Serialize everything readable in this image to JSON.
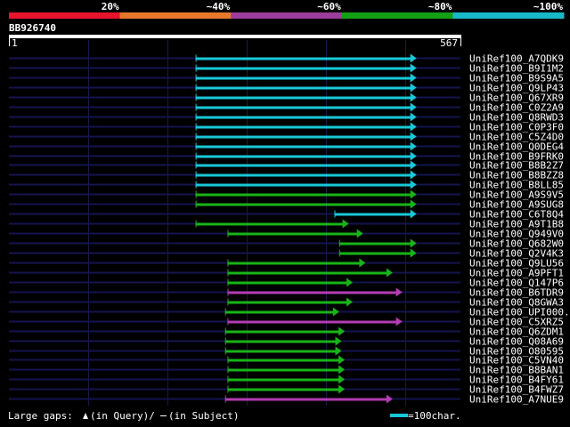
{
  "legend": {
    "colors": [
      "#e8142c",
      "#e8782c",
      "#9c3c9c",
      "#14a014",
      "#18b8c8"
    ],
    "labels": [
      "20%",
      "~40%",
      "~60%",
      "~80%",
      "~100%"
    ]
  },
  "query": {
    "name": "BB926740",
    "start": "1",
    "end": "567"
  },
  "hits": [
    {
      "name": "UniRef100_A7QDK9",
      "start": 235,
      "end": 512,
      "color": "cyan"
    },
    {
      "name": "UniRef100_B9I1M2",
      "start": 235,
      "end": 512,
      "color": "cyan"
    },
    {
      "name": "UniRef100_B9S9A5",
      "start": 235,
      "end": 512,
      "color": "cyan"
    },
    {
      "name": "UniRef100_Q9LP43",
      "start": 235,
      "end": 512,
      "color": "cyan"
    },
    {
      "name": "UniRef100_Q67XR9",
      "start": 235,
      "end": 512,
      "color": "cyan"
    },
    {
      "name": "UniRef100_C0Z2A9",
      "start": 235,
      "end": 512,
      "color": "cyan"
    },
    {
      "name": "UniRef100_Q8RWD3",
      "start": 235,
      "end": 512,
      "color": "cyan"
    },
    {
      "name": "UniRef100_C0P3F0",
      "start": 235,
      "end": 512,
      "color": "cyan"
    },
    {
      "name": "UniRef100_C5Z4D0",
      "start": 235,
      "end": 512,
      "color": "cyan"
    },
    {
      "name": "UniRef100_Q0DEG4",
      "start": 235,
      "end": 512,
      "color": "cyan"
    },
    {
      "name": "UniRef100_B9FRK0",
      "start": 235,
      "end": 512,
      "color": "cyan"
    },
    {
      "name": "UniRef100_B8B2Z7",
      "start": 235,
      "end": 512,
      "color": "cyan"
    },
    {
      "name": "UniRef100_B8BZZ8",
      "start": 235,
      "end": 512,
      "color": "cyan"
    },
    {
      "name": "UniRef100_B8LL85",
      "start": 235,
      "end": 512,
      "color": "cyan"
    },
    {
      "name": "UniRef100_A9S9V5",
      "start": 235,
      "end": 512,
      "color": "green"
    },
    {
      "name": "UniRef100_A9SUG8",
      "start": 235,
      "end": 512,
      "color": "green"
    },
    {
      "name": "UniRef100_C6T8Q4",
      "start": 409,
      "end": 512,
      "color": "cyan"
    },
    {
      "name": "UniRef100_A9T1B8",
      "start": 235,
      "end": 427,
      "color": "green"
    },
    {
      "name": "UniRef100_Q949V0",
      "start": 275,
      "end": 445,
      "color": "green"
    },
    {
      "name": "UniRef100_Q682W0",
      "start": 415,
      "end": 512,
      "color": "green"
    },
    {
      "name": "UniRef100_Q2V4K3",
      "start": 415,
      "end": 512,
      "color": "green"
    },
    {
      "name": "UniRef100_Q9LU56",
      "start": 275,
      "end": 448,
      "color": "green"
    },
    {
      "name": "UniRef100_A9PFT1",
      "start": 275,
      "end": 482,
      "color": "green"
    },
    {
      "name": "UniRef100_Q147P6",
      "start": 275,
      "end": 432,
      "color": "green"
    },
    {
      "name": "UniRef100_B6TDR9",
      "start": 275,
      "end": 494,
      "color": "purple"
    },
    {
      "name": "UniRef100_Q8GWA3",
      "start": 275,
      "end": 432,
      "color": "green"
    },
    {
      "name": "UniRef100_UPI000..",
      "start": 272,
      "end": 415,
      "color": "green"
    },
    {
      "name": "UniRef100_C5XRZ5",
      "start": 275,
      "end": 494,
      "color": "purple"
    },
    {
      "name": "UniRef100_Q6ZDM1",
      "start": 272,
      "end": 422,
      "color": "green"
    },
    {
      "name": "UniRef100_Q08A69",
      "start": 272,
      "end": 418,
      "color": "green"
    },
    {
      "name": "UniRef100_O80595",
      "start": 272,
      "end": 418,
      "color": "green"
    },
    {
      "name": "UniRef100_C5VN40",
      "start": 275,
      "end": 422,
      "color": "green"
    },
    {
      "name": "UniRef100_B8BAN1",
      "start": 275,
      "end": 422,
      "color": "green"
    },
    {
      "name": "UniRef100_B4FY61",
      "start": 275,
      "end": 422,
      "color": "green"
    },
    {
      "name": "UniRef100_B4FWZ7",
      "start": 275,
      "end": 422,
      "color": "green"
    },
    {
      "name": "UniRef100_A7NUE9",
      "start": 272,
      "end": 482,
      "color": "purple"
    }
  ],
  "hitColors": {
    "cyan": "#18c8d8",
    "green": "#18b418",
    "purple": "#b43cb4"
  },
  "footer": {
    "gaps_prefix": "Large gaps:",
    "gaps_query": "(in Query)/",
    "gaps_subject": "(in Subject)",
    "scale_label": "=100char."
  }
}
